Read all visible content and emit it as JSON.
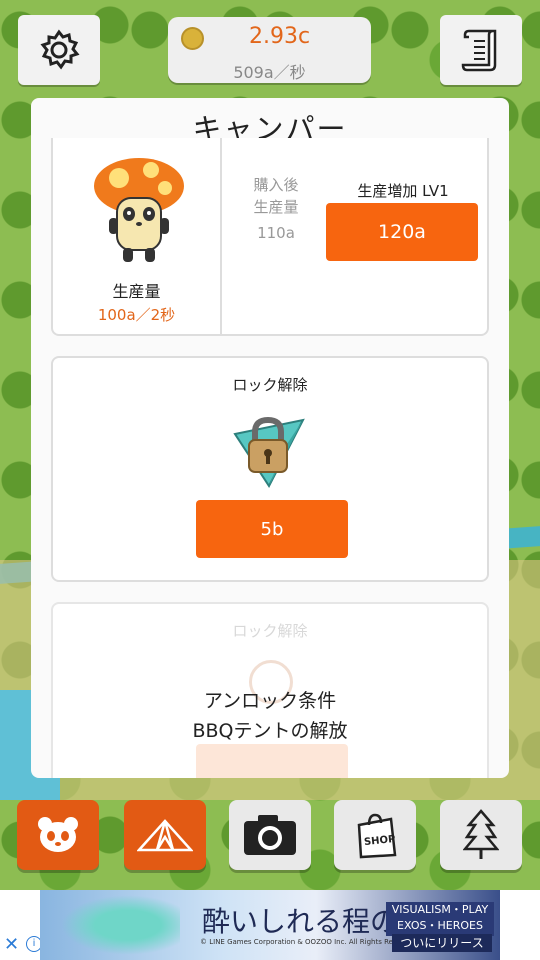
{
  "header": {
    "currency_main": "2.93c",
    "currency_rate": "509a／秒"
  },
  "panel": {
    "title": "キャンパー",
    "card_produce": {
      "production_label": "生産量",
      "production_value": "100a／2秒",
      "after_purchase_label": "購入後\n生産量",
      "after_purchase_value": "110a",
      "upgrade_label": "生産増加 LV1",
      "upgrade_price": "120a"
    },
    "card_unlock": {
      "label": "ロック解除",
      "price": "5b"
    },
    "card_locked": {
      "label": "ロック解除",
      "condition_title": "アンロック条件",
      "condition_text": "BBQテントの解放"
    }
  },
  "bottom_nav": [
    "panda-icon",
    "tent-icon",
    "camera-icon",
    "shop-bag-icon",
    "tree-icon"
  ],
  "ad": {
    "headline": "酔いしれる程の美しさ",
    "copyright": "© LINE Games Corporation & OOZOO Inc. All Rights Reserved.",
    "game_name": "VISUALISM・PLAY\nEXOS・HEROES",
    "release": "ついにリリース",
    "close": "✕",
    "info": "i"
  },
  "colors": {
    "accent": "#f7650f",
    "currency": "#e2661a"
  }
}
